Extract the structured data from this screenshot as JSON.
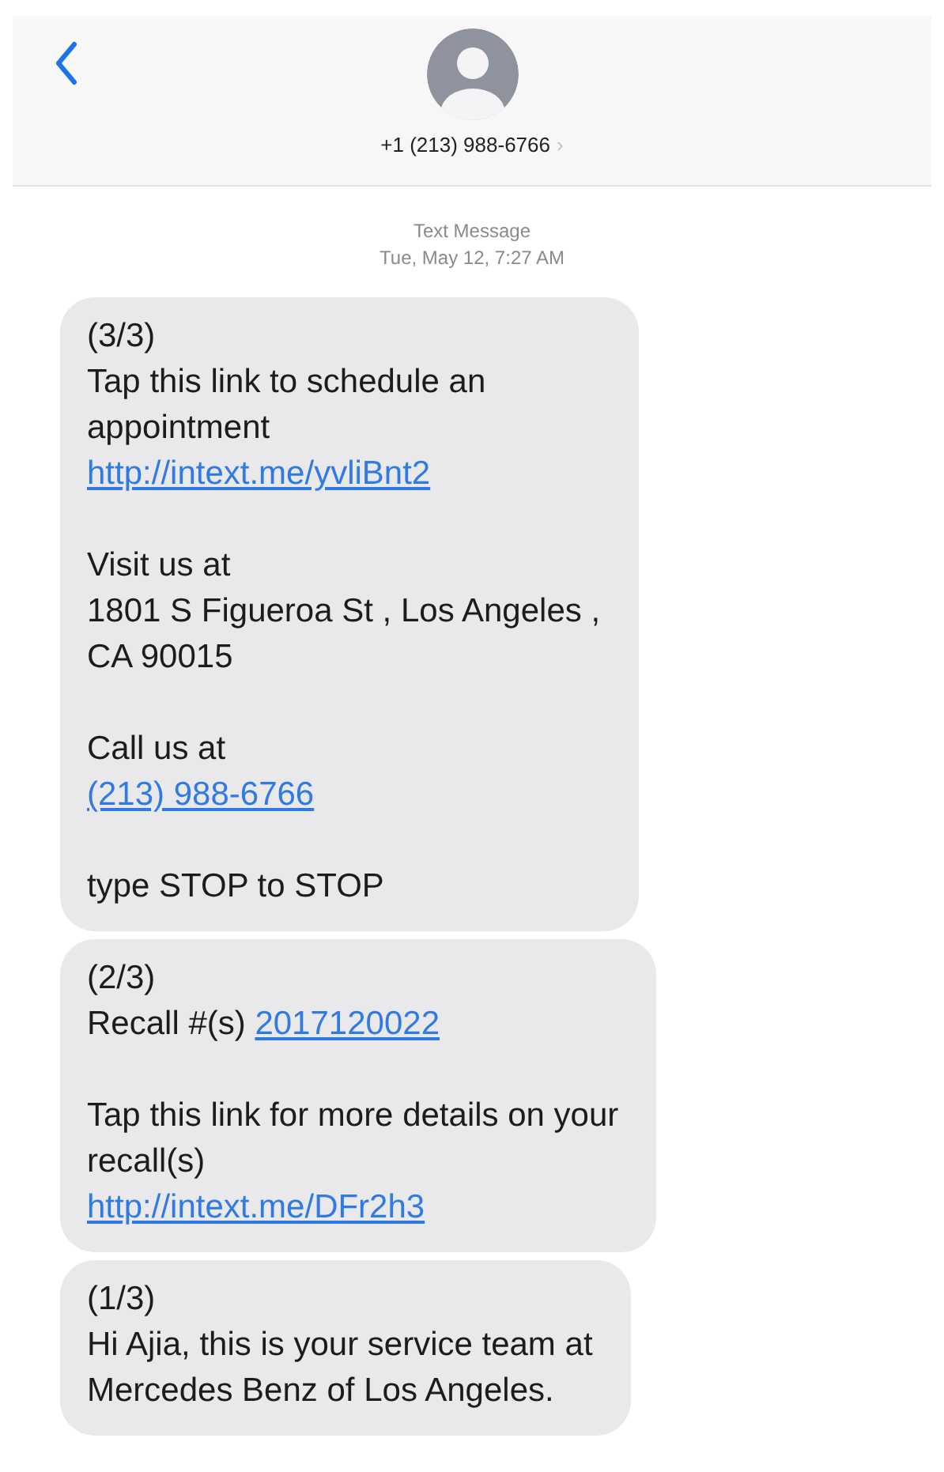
{
  "header": {
    "contact": "+1 (213) 988-6766",
    "chevron": "›"
  },
  "timestamp": {
    "label": "Text Message",
    "time": "Tue, May 12, 7:27 AM"
  },
  "messages": [
    {
      "paragraphs": [
        [
          [
            {
              "kind": "text",
              "text": "(3/3)"
            }
          ],
          [
            {
              "kind": "text",
              "text": "Tap this link to schedule an"
            }
          ],
          [
            {
              "kind": "text",
              "text": "appointment"
            }
          ],
          [
            {
              "kind": "link",
              "text": "http://intext.me/yvliBnt2"
            }
          ]
        ],
        [
          [
            {
              "kind": "text",
              "text": "Visit us at"
            }
          ],
          [
            {
              "kind": "text",
              "text": "1801 S Figueroa St , Los Angeles ,"
            }
          ],
          [
            {
              "kind": "text",
              "text": "CA 90015"
            }
          ]
        ],
        [
          [
            {
              "kind": "text",
              "text": "Call us at"
            }
          ],
          [
            {
              "kind": "link",
              "text": "(213) 988-6766"
            }
          ]
        ],
        [
          [
            {
              "kind": "text",
              "text": "type STOP to STOP"
            }
          ]
        ]
      ]
    },
    {
      "paragraphs": [
        [
          [
            {
              "kind": "text",
              "text": "(2/3)"
            }
          ],
          [
            {
              "kind": "text",
              "text": "Recall #(s) "
            },
            {
              "kind": "link",
              "text": "2017120022"
            }
          ]
        ],
        [
          [
            {
              "kind": "text",
              "text": "Tap this link for more details on your"
            }
          ],
          [
            {
              "kind": "text",
              "text": "recall(s)"
            }
          ],
          [
            {
              "kind": "link",
              "text": "http://intext.me/DFr2h3"
            }
          ]
        ]
      ]
    },
    {
      "paragraphs": [
        [
          [
            {
              "kind": "text",
              "text": "(1/3)"
            }
          ],
          [
            {
              "kind": "text",
              "text": "Hi Ajia, this is your service team at"
            }
          ],
          [
            {
              "kind": "text",
              "text": "Mercedes Benz of Los Angeles."
            }
          ]
        ]
      ]
    }
  ]
}
